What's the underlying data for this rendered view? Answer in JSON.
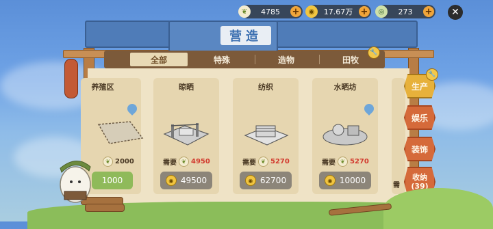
{
  "resources": [
    {
      "icon": "sprout-icon",
      "value": "4785"
    },
    {
      "icon": "coin-icon",
      "value": "17.67万"
    },
    {
      "icon": "gem-icon",
      "value": "273"
    }
  ],
  "panel_title": "营造",
  "tabs": [
    {
      "label": "全部",
      "active": true
    },
    {
      "label": "特殊",
      "active": false
    },
    {
      "label": "造物",
      "active": false
    },
    {
      "label": "田牧",
      "active": false
    }
  ],
  "side_tabs": [
    {
      "label": "生产",
      "active": true
    },
    {
      "label": "娱乐",
      "active": false
    },
    {
      "label": "装饰",
      "active": false
    },
    {
      "label": "收纳",
      "count": "(39)",
      "active": false
    }
  ],
  "cards": [
    {
      "name": "养殖区",
      "need_label": "",
      "need_value": "2000",
      "cost": "1000",
      "affordable": true,
      "water": true
    },
    {
      "name": "晾晒",
      "need_label": "需要",
      "need_value": "4950",
      "cost": "49500",
      "affordable": false,
      "water": false
    },
    {
      "name": "纺织",
      "need_label": "需要",
      "need_value": "5270",
      "cost": "62700",
      "affordable": false,
      "water": false
    },
    {
      "name": "水晒坊",
      "need_label": "需要",
      "need_value": "5270",
      "cost": "10000",
      "affordable": false,
      "water": true
    },
    {
      "name": "",
      "need_label": "需",
      "need_value": "",
      "cost": "",
      "affordable": false,
      "water": false
    }
  ],
  "colors": {
    "accent_side": "#d56a3a",
    "active_side": "#e7b13b",
    "red_requirement": "#d23a2e",
    "roof": "#4f7cb8"
  }
}
